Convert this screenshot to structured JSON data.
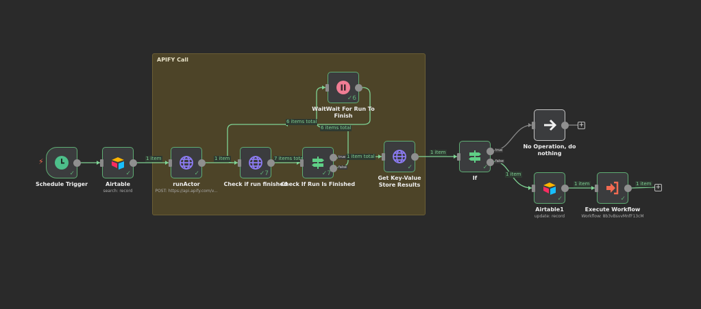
{
  "group": {
    "title": "APIFY Call",
    "color": "#4d4428"
  },
  "colors": {
    "success": "#5fae74",
    "canvas": "#2a2a2a",
    "node": "#3b3c3e"
  },
  "nodes": {
    "schedule": {
      "label": "Schedule Trigger",
      "icon": "clock-icon"
    },
    "airtable": {
      "label": "Airtable",
      "sub": "search: record",
      "icon": "airtable-icon"
    },
    "runactor": {
      "label": "runActor",
      "sub": "POST: https://api.apify.com/v...",
      "icon": "globe-icon"
    },
    "checkrun": {
      "label": "Check if run finished",
      "count": "7",
      "icon": "globe-icon"
    },
    "checkif": {
      "label": "Check If Run Is Finished",
      "count": "7",
      "icon": "signpost-icon",
      "true_label": "true",
      "false_label": "false"
    },
    "wait": {
      "label": "WaitWait For Run To Finish",
      "count": "6",
      "icon": "pause-icon"
    },
    "getkv": {
      "label": "Get Key-Value Store Results",
      "icon": "globe-icon"
    },
    "if": {
      "label": "If",
      "icon": "signpost-icon",
      "true_label": "true",
      "false_label": "false"
    },
    "noop": {
      "label": "No Operation, do nothing",
      "icon": "arrow-right-icon"
    },
    "airtable1": {
      "label": "Airtable1",
      "sub": "update: record",
      "icon": "airtable-icon"
    },
    "execwf": {
      "label": "Execute Workflow",
      "sub": "Workflow: 8b3vBsvvMnfF13cM",
      "icon": "sign-in-icon"
    }
  },
  "edges": {
    "airtable_runactor": "1 item",
    "runactor_checkrun": "1 item",
    "checkrun_checkif": "7 items total",
    "wait_checkrun": "6 items total",
    "checkif_wait": "6 items total",
    "checkif_getkv": "1 item total",
    "getkv_if": "1 item",
    "if_airtable1": "1 item",
    "airtable1_execwf": "1 item",
    "execwf_out": "1 item"
  },
  "plus_symbol": "+"
}
